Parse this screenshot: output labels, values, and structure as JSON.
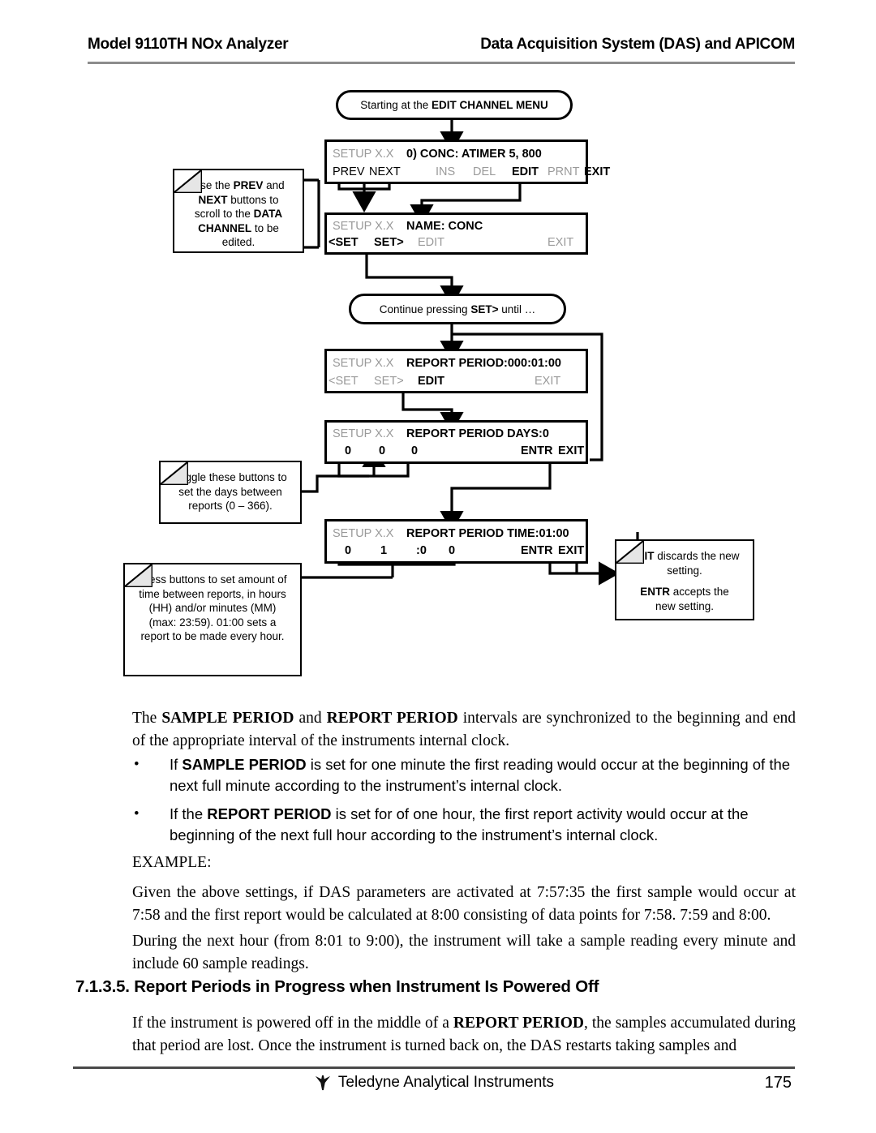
{
  "header": {
    "left": "Model 9110TH NOx Analyzer",
    "right": "Data Acquisition System (DAS) and APICOM"
  },
  "diagram": {
    "start_terminator": {
      "prefix": "Starting at the ",
      "emphasis": "EDIT CHANNEL MENU"
    },
    "continue_terminator": {
      "prefix": "Continue pressing ",
      "emphasis": "SET>",
      "suffix": " until …"
    },
    "screens": [
      {
        "id": "conc-screen",
        "setup": "SETUP X.X",
        "title": "0) CONC:  ATIMER 5, 800",
        "buttons": [
          {
            "label": "PREV",
            "state": "active"
          },
          {
            "label": "NEXT",
            "state": "active"
          },
          {
            "label": "INS",
            "state": "dim"
          },
          {
            "label": "DEL",
            "state": "dim"
          },
          {
            "label": "EDIT",
            "state": "active"
          },
          {
            "label": "PRNT",
            "state": "dim"
          },
          {
            "label": "EXIT",
            "state": "active"
          }
        ]
      },
      {
        "id": "name-screen",
        "setup": "SETUP X.X",
        "title": "NAME: CONC",
        "buttons": [
          {
            "label": "<SET",
            "state": "active"
          },
          {
            "label": "SET>",
            "state": "active"
          },
          {
            "label": "EDIT",
            "state": "dim"
          },
          {
            "label": "EXIT",
            "state": "dim"
          }
        ]
      },
      {
        "id": "report-period-screen",
        "setup": "SETUP X.X",
        "title": "REPORT PERIOD:000:01:00",
        "buttons": [
          {
            "label": "<SET",
            "state": "dim"
          },
          {
            "label": "SET>",
            "state": "dim"
          },
          {
            "label": "EDIT",
            "state": "active"
          },
          {
            "label": "EXIT",
            "state": "dim"
          }
        ]
      },
      {
        "id": "report-period-days-screen",
        "setup": "SETUP X.X",
        "title": "REPORT PERIOD DAYS:0",
        "digits": [
          "0",
          "0",
          "0"
        ],
        "buttons": [
          {
            "label": "ENTR",
            "state": "active"
          },
          {
            "label": "EXIT",
            "state": "active"
          }
        ]
      },
      {
        "id": "report-period-time-screen",
        "setup": "SETUP X.X",
        "title": "REPORT PERIOD TIME:01:00",
        "digits": [
          "0",
          "1",
          ":0",
          "0"
        ],
        "buttons": [
          {
            "label": "ENTR",
            "state": "active"
          },
          {
            "label": "EXIT",
            "state": "active"
          }
        ]
      }
    ],
    "notes": [
      {
        "id": "note-prev-next",
        "lines": [
          [
            {
              "t": "Use the ",
              "b": false
            },
            {
              "t": "PREV",
              "b": true
            },
            {
              "t": " and",
              "b": false
            }
          ],
          [
            {
              "t": "NEXT",
              "b": true
            },
            {
              "t": " buttons to",
              "b": false
            }
          ],
          [
            {
              "t": "scroll to the ",
              "b": false
            },
            {
              "t": "DATA",
              "b": true
            }
          ],
          [
            {
              "t": "CHANNEL",
              "b": true
            },
            {
              "t": " to be",
              "b": false
            }
          ],
          [
            {
              "t": "edited.",
              "b": false
            }
          ]
        ]
      },
      {
        "id": "note-days",
        "lines": [
          [
            {
              "t": "Toggle these buttons to",
              "b": false
            }
          ],
          [
            {
              "t": "set the days between",
              "b": false
            }
          ],
          [
            {
              "t": "reports (0 – 366).",
              "b": false
            }
          ]
        ]
      },
      {
        "id": "note-time",
        "lines": [
          [
            {
              "t": "Press buttons to set amount of",
              "b": false
            }
          ],
          [
            {
              "t": "time between reports, in hours",
              "b": false
            }
          ],
          [
            {
              "t": "(HH) and/or minutes (MM)",
              "b": false
            }
          ],
          [
            {
              "t": "(max: 23:59). 01:00 sets a",
              "b": false
            }
          ],
          [
            {
              "t": "report to be made every hour.",
              "b": false
            }
          ]
        ]
      },
      {
        "id": "note-entr-exit",
        "lines": [
          [
            {
              "t": "EXIT",
              "b": true
            },
            {
              "t": " discards the new",
              "b": false
            }
          ],
          [
            {
              "t": "setting.",
              "b": false
            }
          ],
          [
            {
              "t": "",
              "b": false
            }
          ],
          [
            {
              "t": "ENTR",
              "b": true
            },
            {
              "t": " accepts the",
              "b": false
            }
          ],
          [
            {
              "t": "new setting.",
              "b": false
            }
          ]
        ]
      }
    ]
  },
  "body": {
    "intro": [
      {
        "t": "The ",
        "b": false
      },
      {
        "t": "SAMPLE PERIOD",
        "b": true
      },
      {
        "t": " and ",
        "b": false
      },
      {
        "t": "REPORT PERIOD",
        "b": true
      },
      {
        "t": " intervals are synchronized to the beginning and end of the appropriate interval of the instruments internal clock.",
        "b": false
      }
    ],
    "bullet_glyph": "•",
    "bullets": [
      [
        {
          "t": "If ",
          "b": false
        },
        {
          "t": "SAMPLE PERIOD",
          "b": true
        },
        {
          "t": " is set for one minute the first reading would occur at the beginning of the next full minute according to the instrument’s internal clock.",
          "b": false
        }
      ],
      [
        {
          "t": "If the ",
          "b": false
        },
        {
          "t": "REPORT PERIOD",
          "b": true
        },
        {
          "t": " is set for of one hour, the first report activity would occur at the beginning of the next full hour according to the instrument’s internal clock.",
          "b": false
        }
      ]
    ],
    "example_label": "EXAMPLE:",
    "example_para": [
      {
        "t": "Given the above settings, if DAS parameters are activated at 7:57:35 the first sample would occur at 7:58 and the first report would be calculated at 8:00 consisting of data points for 7:58.  7:59 and 8:00.",
        "b": false
      }
    ],
    "during_para": [
      {
        "t": "During the next hour (from 8:01 to 9:00), the instrument will take a sample reading every minute and include 60 sample readings.",
        "b": false
      }
    ],
    "section_heading": "7.1.3.5. Report Periods in Progress when Instrument Is Powered Off",
    "closing_para": [
      {
        "t": "If the instrument is powered off in the middle of a ",
        "b": false
      },
      {
        "t": "REPORT PERIOD",
        "b": true
      },
      {
        "t": ", the samples accumulated during that period are lost.   Once the instrument is turned back on, the DAS restarts taking samples and",
        "b": false
      }
    ]
  },
  "footer": {
    "company": "Teledyne Analytical Instruments",
    "page_number": "175",
    "logo_name": "teledyne-logo"
  }
}
